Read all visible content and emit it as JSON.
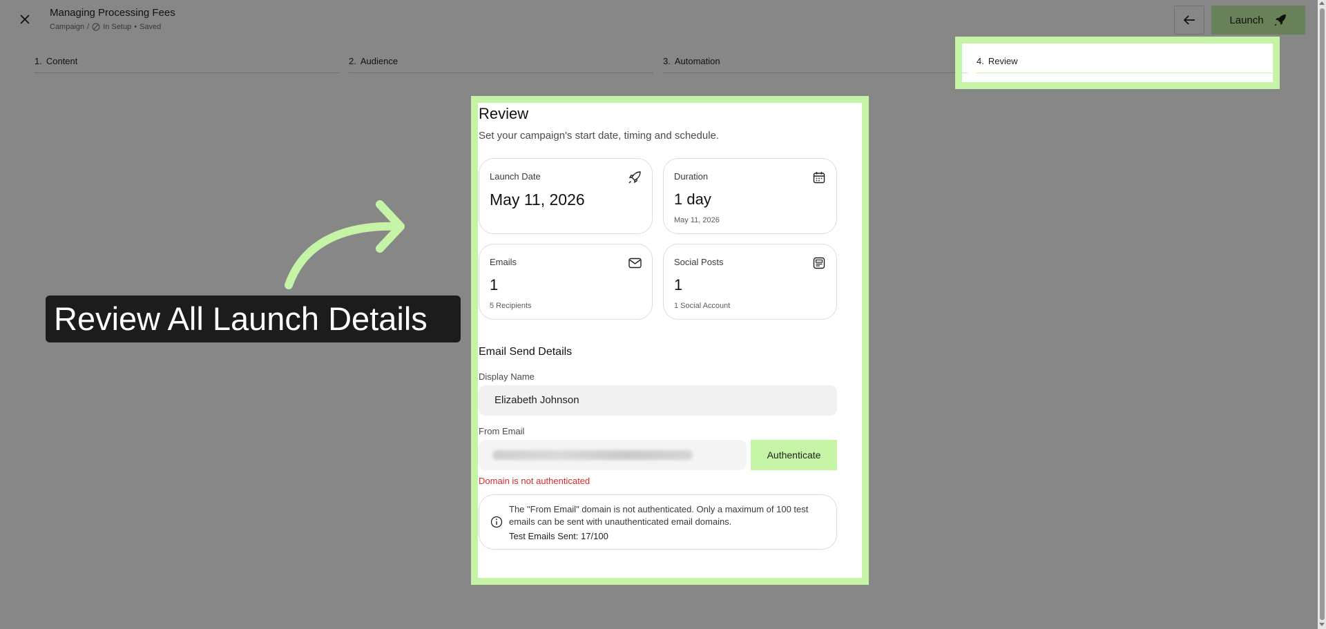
{
  "header": {
    "title": "Managing Processing Fees",
    "breadcrumb": "Campaign",
    "separator": "/",
    "status": "In Setup",
    "dot": "•",
    "saved": "Saved",
    "launch_label": "Launch"
  },
  "steps": [
    {
      "num": "1.",
      "label": "Content"
    },
    {
      "num": "2.",
      "label": "Audience"
    },
    {
      "num": "3.",
      "label": "Automation"
    },
    {
      "num": "4.",
      "label": "Review"
    }
  ],
  "review": {
    "title": "Review",
    "subtitle": "Set your campaign's start date, timing and schedule.",
    "stats": {
      "launch": {
        "label": "Launch Date",
        "value": "May 11, 2026",
        "icon": "rocket-icon"
      },
      "duration": {
        "label": "Duration",
        "value": "1 day",
        "note": "May 11, 2026",
        "icon": "calendar-icon"
      },
      "emails": {
        "label": "Emails",
        "value": "1",
        "note": "5 Recipients",
        "icon": "mail-icon"
      },
      "social": {
        "label": "Social Posts",
        "value": "1",
        "note": "1 Social Account",
        "icon": "post-icon"
      }
    },
    "email_section_title": "Email Send Details",
    "display_name_label": "Display Name",
    "display_name_value": "Elizabeth Johnson",
    "from_email_label": "From Email",
    "authenticate_label": "Authenticate",
    "error": "Domain is not authenticated",
    "info_message": "The \"From Email\" domain is not authenticated. Only a maximum of 100 test emails can be sent with unauthenticated email domains.",
    "test_emails": "Test Emails Sent: 17/100"
  },
  "annotation": {
    "callout": "Review All Launch Details"
  },
  "colors": {
    "accent": "#c6f4a6",
    "error": "#d52b2b",
    "callout_bg": "#1c1c1c"
  }
}
